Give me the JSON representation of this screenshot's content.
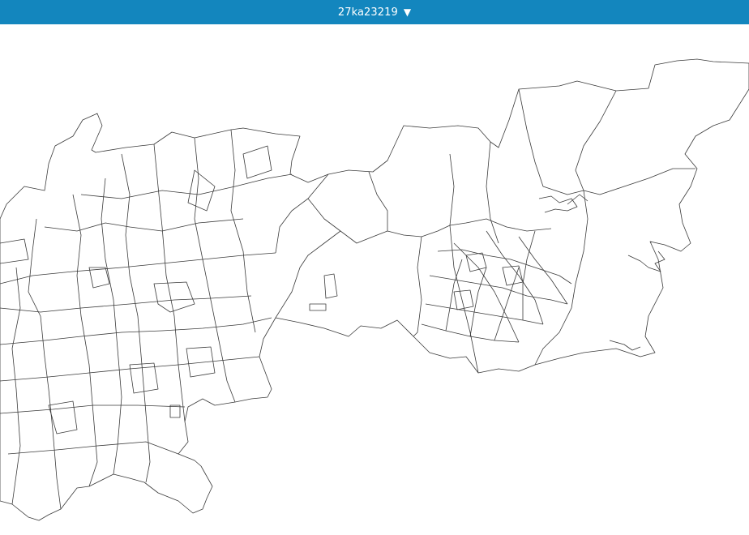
{
  "header": {
    "title": "27ka23219",
    "dropdown_icon": "triangle-down-icon",
    "dropdown_glyph": "▼"
  },
  "colors": {
    "header_bg": "#1386be",
    "header_text": "#ffffff",
    "map_bg": "#ffffff",
    "boundary": "#3a3a3a"
  }
}
